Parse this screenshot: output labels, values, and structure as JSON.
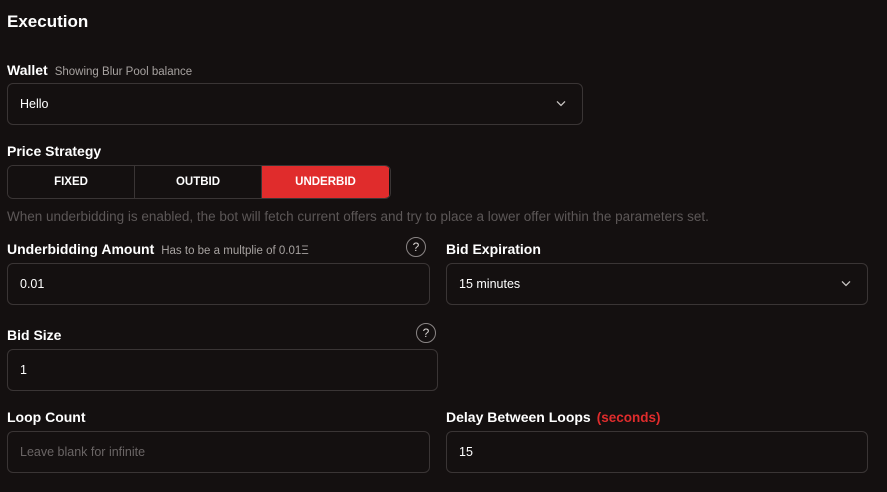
{
  "section": {
    "title": "Execution"
  },
  "wallet": {
    "label": "Wallet",
    "hint": "Showing Blur Pool balance",
    "value": "Hello"
  },
  "price_strategy": {
    "label": "Price Strategy",
    "options": [
      "FIXED",
      "OUTBID",
      "UNDERBID"
    ],
    "selected": "UNDERBID",
    "description": "When underbidding is enabled, the bot will fetch current offers and try to place a lower offer within the parameters set."
  },
  "underbidding_amount": {
    "label": "Underbidding Amount",
    "hint": "Has to be a multplie of 0.01Ξ",
    "value": "0.01",
    "help": "?"
  },
  "bid_expiration": {
    "label": "Bid Expiration",
    "value": "15 minutes"
  },
  "bid_size": {
    "label": "Bid Size",
    "value": "1",
    "help": "?"
  },
  "loop_count": {
    "label": "Loop Count",
    "placeholder": "Leave blank for infinite"
  },
  "delay_between_loops": {
    "label": "Delay Between Loops",
    "unit": "(seconds)",
    "value": "15"
  },
  "colors": {
    "accent": "#e02c2c",
    "background": "#141010",
    "border": "#3a3535"
  }
}
